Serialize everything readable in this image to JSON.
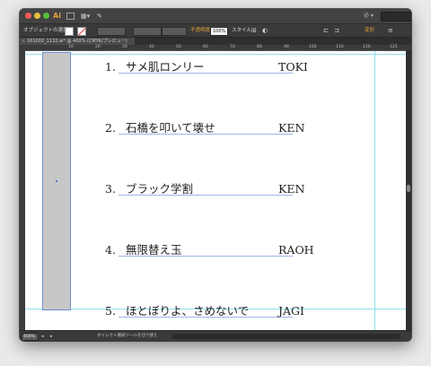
{
  "app": {
    "logo": "Ai",
    "workspace_label": "必 ▾",
    "doc_tab": "161002_1132.ai* @ 400% (CMYK/プレビュー)"
  },
  "control_bar": {
    "selection_label": "オブジェクトの選択",
    "opacity_label": "不透明度",
    "opacity_value": "100%",
    "style_label": "スタイル",
    "transform_label": "変形"
  },
  "ruler_ticks": [
    "10",
    "20",
    "30",
    "40",
    "50",
    "60",
    "70",
    "80",
    "90",
    "100",
    "110",
    "120",
    "125"
  ],
  "list_rows": [
    {
      "num": "1.",
      "title": "サメ肌ロンリー",
      "author": "TOKI"
    },
    {
      "num": "2.",
      "title": "石橋を叩いて壊せ",
      "author": "KEN"
    },
    {
      "num": "3.",
      "title": "ブラック学割",
      "author": "KEN"
    },
    {
      "num": "4.",
      "title": "無限替え玉",
      "author": "RAOH"
    },
    {
      "num": "5.",
      "title": "ほとぼりよ、さめないで",
      "author": "JAGI"
    }
  ],
  "status": {
    "zoom": "400%",
    "tool_hint": "ダイレクト選択ツールを切り替え"
  },
  "colors": {
    "guide": "#8fe0ee",
    "selection": "#4f74d4",
    "accent_orange": "#e8a13a"
  }
}
